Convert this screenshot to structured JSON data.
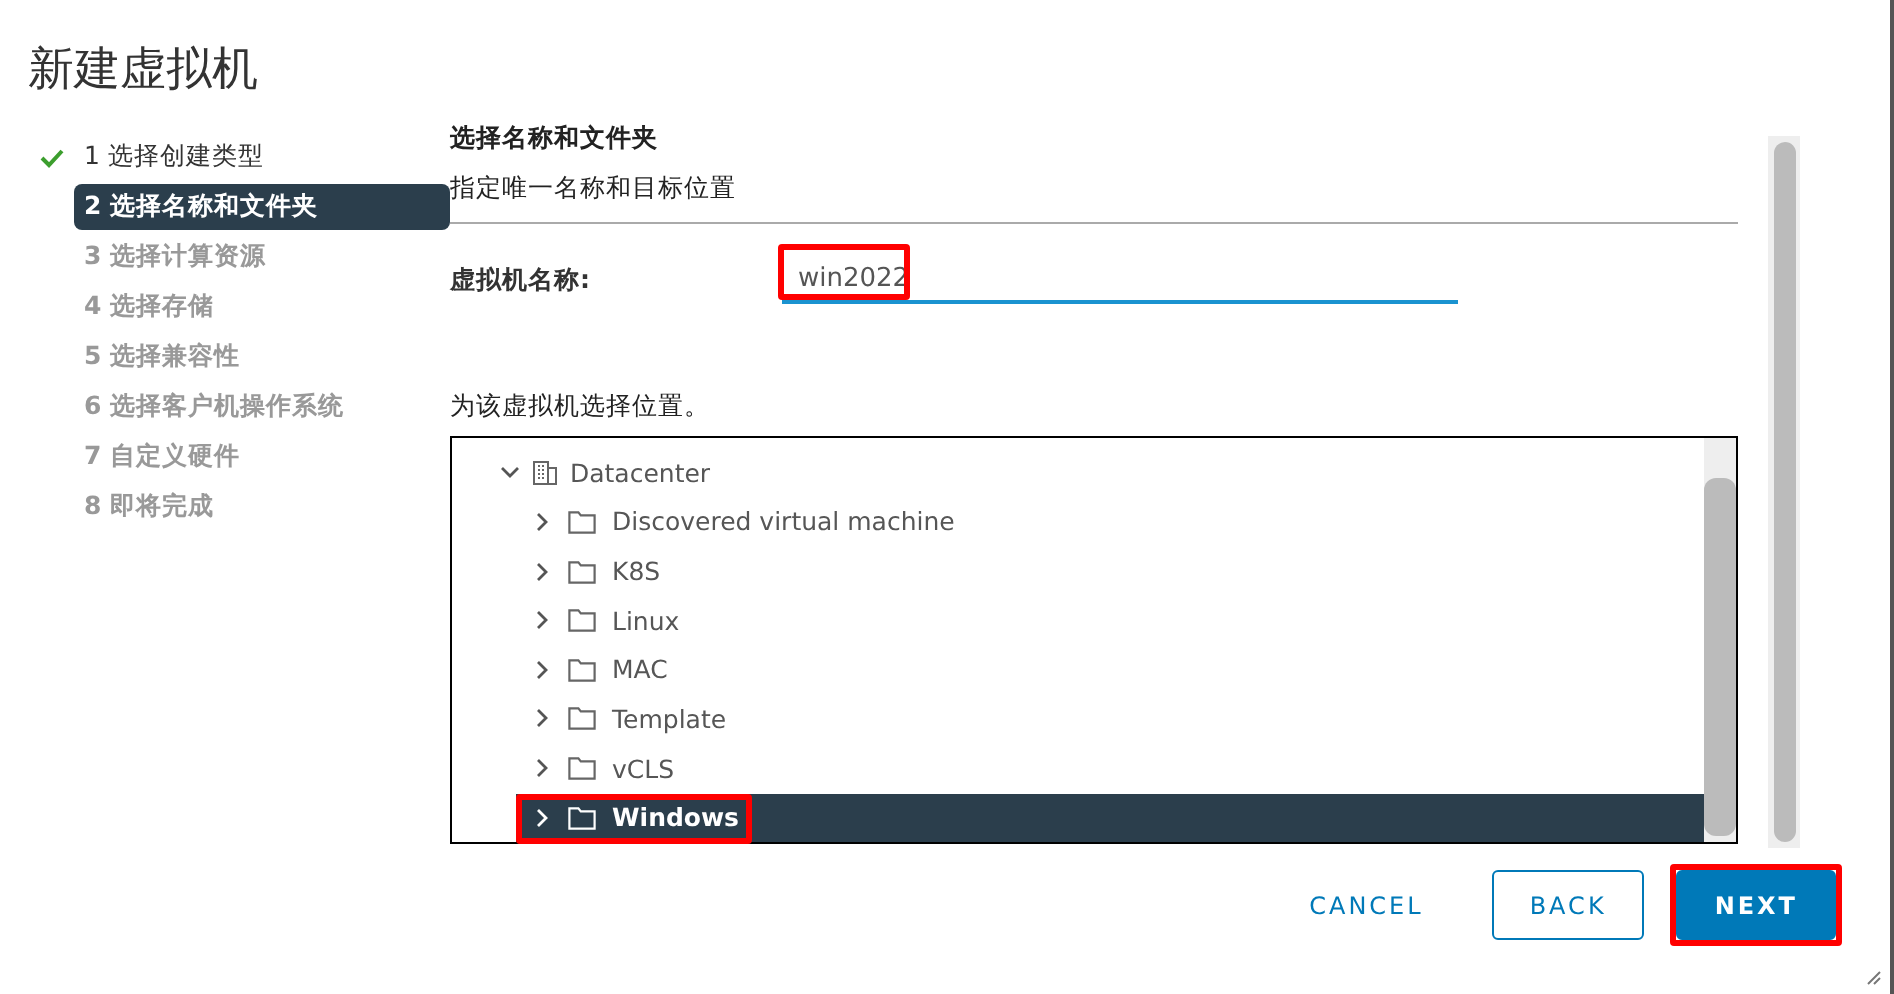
{
  "window": {
    "title": "新建虚拟机"
  },
  "steps": [
    {
      "label": "1 选择创建类型",
      "completed": true,
      "selected": false
    },
    {
      "label": "2 选择名称和文件夹",
      "completed": false,
      "selected": true
    },
    {
      "label": "3 选择计算资源",
      "completed": false,
      "selected": false
    },
    {
      "label": "4 选择存储",
      "completed": false,
      "selected": false
    },
    {
      "label": "5 选择兼容性",
      "completed": false,
      "selected": false
    },
    {
      "label": "6 选择客户机操作系统",
      "completed": false,
      "selected": false
    },
    {
      "label": "7 自定义硬件",
      "completed": false,
      "selected": false
    },
    {
      "label": "8 即将完成",
      "completed": false,
      "selected": false
    }
  ],
  "heading": "选择名称和文件夹",
  "subheading": "指定唯一名称和目标位置",
  "name_field": {
    "label": "虚拟机名称:",
    "value": "win2022",
    "highlighted": true
  },
  "location_prompt": "为该虚拟机选择位置。",
  "tree": {
    "label": "Datacenter",
    "expanded": true,
    "children": [
      {
        "label": "Discovered virtual machine",
        "selected": false,
        "highlighted": false
      },
      {
        "label": "K8S",
        "selected": false,
        "highlighted": false
      },
      {
        "label": "Linux",
        "selected": false,
        "highlighted": false
      },
      {
        "label": "MAC",
        "selected": false,
        "highlighted": false
      },
      {
        "label": "Template",
        "selected": false,
        "highlighted": false
      },
      {
        "label": "vCLS",
        "selected": false,
        "highlighted": false
      },
      {
        "label": "Windows",
        "selected": true,
        "highlighted": true
      }
    ]
  },
  "buttons": [
    {
      "label": "CANCEL",
      "kind": "link",
      "highlighted": false
    },
    {
      "label": "BACK",
      "kind": "outline",
      "highlighted": false
    },
    {
      "label": "NEXT",
      "kind": "primary",
      "highlighted": true
    }
  ]
}
